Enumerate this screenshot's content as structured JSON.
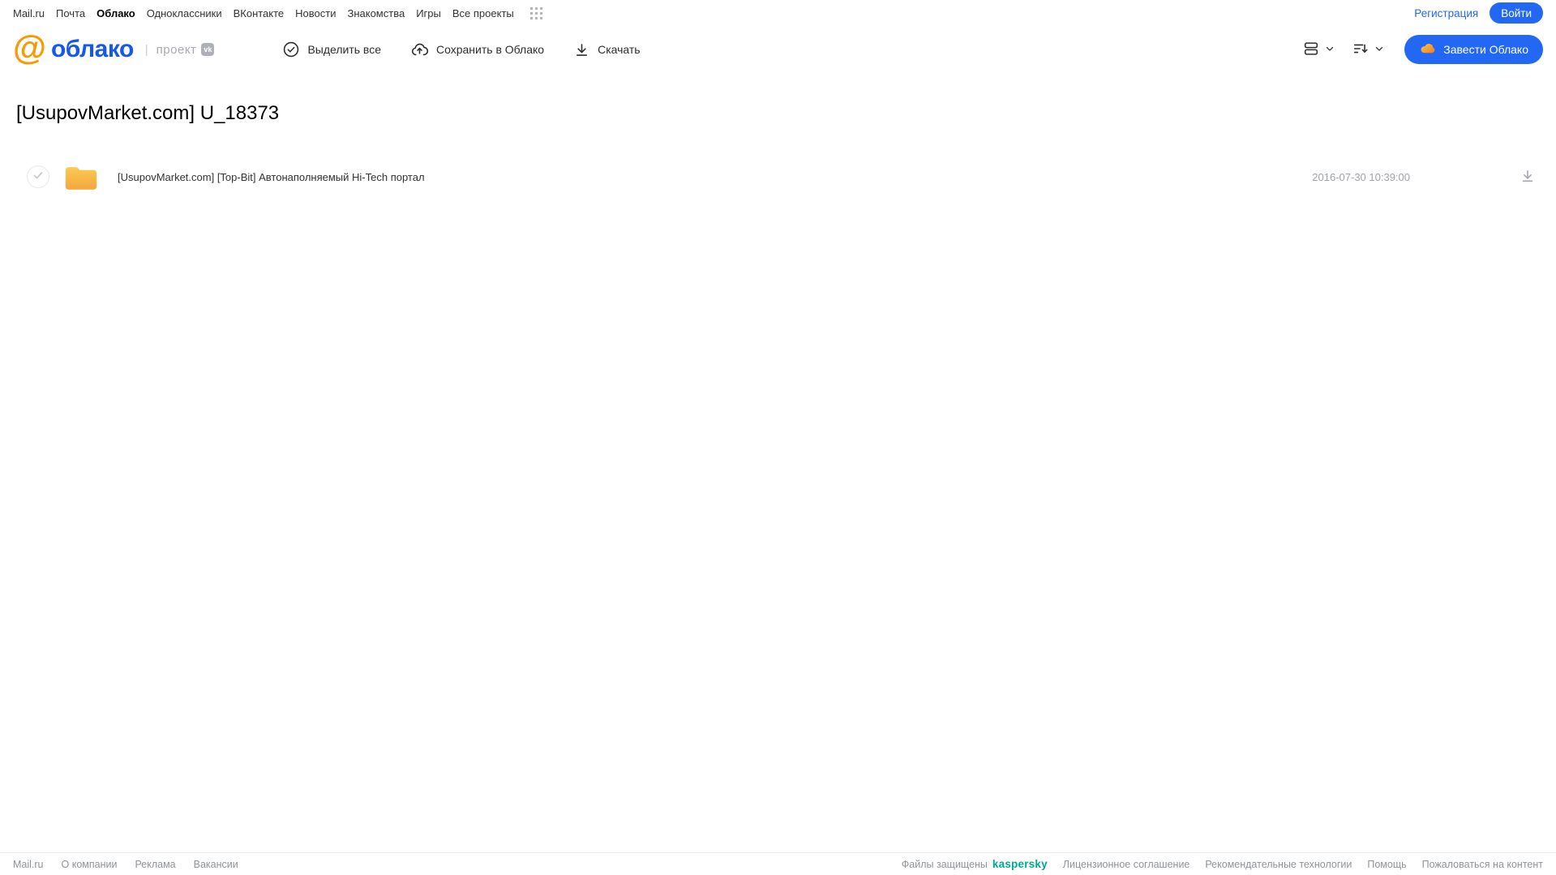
{
  "topnav": {
    "links": [
      "Mail.ru",
      "Почта",
      "Облако",
      "Одноклассники",
      "ВКонтакте",
      "Новости",
      "Знакомства",
      "Игры",
      "Все проекты"
    ],
    "active_link": "Облако",
    "registration": "Регистрация",
    "login": "Войти"
  },
  "header": {
    "brand_at": "@",
    "brand": "облако",
    "project_divider": "|",
    "project_label": "проект",
    "vk_badge": "vk",
    "actions": {
      "select_all": "Выделить все",
      "save_to_cloud": "Сохранить в Облако",
      "download": "Скачать"
    },
    "get_cloud": "Завести Облако"
  },
  "page": {
    "title": "[UsupovMarket.com] U_18373"
  },
  "files": [
    {
      "type": "folder",
      "name": "[UsupovMarket.com] [Top-Bit] Автонаполняемый Hi-Tech портал",
      "date": "2016-07-30 10:39:00"
    }
  ],
  "footer": {
    "left_links": [
      "Mail.ru",
      "О компании",
      "Реклама",
      "Вакансии"
    ],
    "protected_label": "Файлы защищены",
    "kaspersky": "kaspersky",
    "right_links": [
      "Лицензионное соглашение",
      "Рекомендательные технологии",
      "Помощь",
      "Пожаловаться на контент"
    ]
  },
  "colors": {
    "accent_blue": "#2368f4",
    "brand_orange": "#fb9901",
    "brand_blue": "#1657ee",
    "kaspersky_teal": "#00a88e",
    "folder_top": "#facb55",
    "folder_bottom": "#f5a53b"
  }
}
